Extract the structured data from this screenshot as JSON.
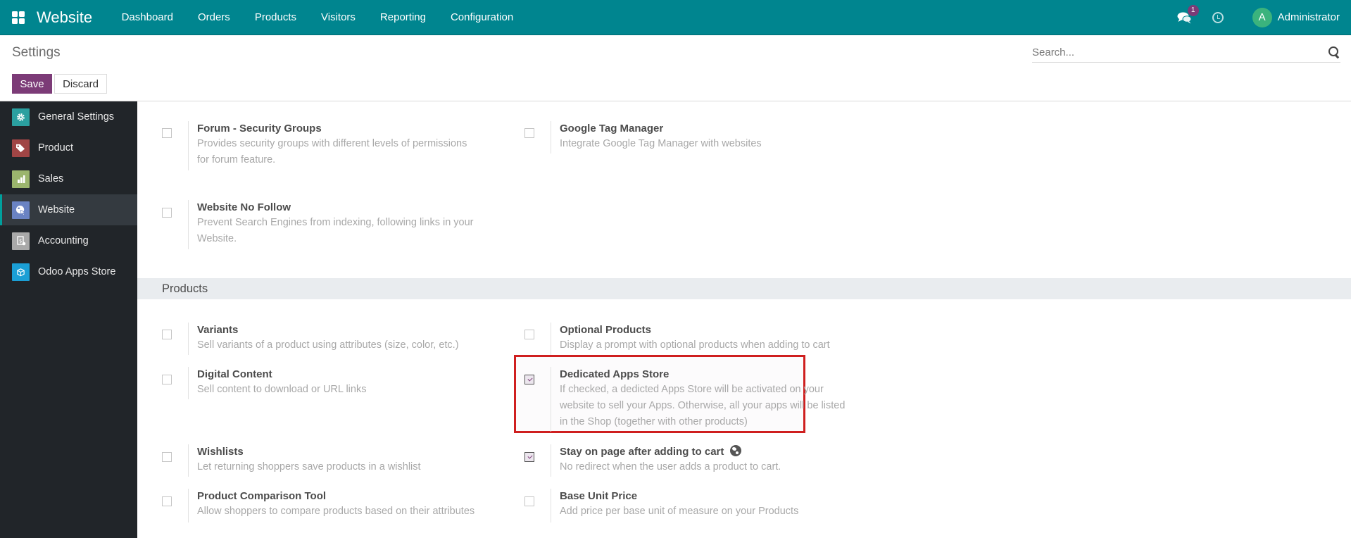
{
  "navbar": {
    "app_name": "Website",
    "menu": [
      "Dashboard",
      "Orders",
      "Products",
      "Visitors",
      "Reporting",
      "Configuration"
    ],
    "messages_badge": "1",
    "user_initial": "A",
    "user_name": "Administrator",
    "brand_color": "#00858f"
  },
  "control_panel": {
    "title": "Settings",
    "save_label": "Save",
    "discard_label": "Discard",
    "search_placeholder": "Search..."
  },
  "sidebar": {
    "items": [
      {
        "label": "General Settings",
        "icon": "gear-icon",
        "color": "#2ba0a0",
        "active": false
      },
      {
        "label": "Product",
        "icon": "tag-icon",
        "color": "#a04545",
        "active": false
      },
      {
        "label": "Sales",
        "icon": "chart-icon",
        "color": "#9bb56d",
        "active": false
      },
      {
        "label": "Website",
        "icon": "globe-cursor-icon",
        "color": "#6a83c3",
        "active": true
      },
      {
        "label": "Accounting",
        "icon": "invoice-icon",
        "color": "#a9a9a9",
        "active": false
      },
      {
        "label": "Odoo Apps Store",
        "icon": "cube-icon",
        "color": "#1b9fd5",
        "active": false
      }
    ]
  },
  "settings": {
    "top": [
      {
        "title": "Forum - Security Groups",
        "desc": [
          "Provides security groups with different levels of permissions",
          "for forum feature."
        ],
        "checked": false
      },
      {
        "title": "Google Tag Manager",
        "desc": [
          "Integrate Google Tag Manager with websites"
        ],
        "checked": false
      },
      {
        "title": "Website No Follow",
        "desc": [
          "Prevent Search Engines from indexing, following links in your",
          "Website."
        ],
        "checked": false
      }
    ],
    "products_section": {
      "header": "Products",
      "items": [
        {
          "title": "Variants",
          "desc": [
            "Sell variants of a product using attributes (size, color, etc.)"
          ],
          "checked": false
        },
        {
          "title": "Optional Products",
          "desc": [
            "Display a prompt with optional products when adding to cart"
          ],
          "checked": false
        },
        {
          "title": "Digital Content",
          "desc": [
            "Sell content to download or URL links"
          ],
          "checked": false
        },
        {
          "title": "Dedicated Apps Store",
          "desc": [
            "If checked, a dedicted Apps Store will be activated on your",
            "website to sell your Apps. Otherwise, all your apps will be listed",
            "in the Shop (together with other products)"
          ],
          "checked": true,
          "highlighted": true
        },
        {
          "title": "Wishlists",
          "desc": [
            "Let returning shoppers save products in a wishlist"
          ],
          "checked": false
        },
        {
          "title": "Stay on page after adding to cart",
          "desc": [
            "No redirect when the user adds a product to cart."
          ],
          "checked": true,
          "icon": "globe-icon"
        },
        {
          "title": "Product Comparison Tool",
          "desc": [
            "Allow shoppers to compare products based on their attributes"
          ],
          "checked": false
        },
        {
          "title": "Base Unit Price",
          "desc": [
            "Add price per base unit of measure on your Products"
          ],
          "checked": false
        }
      ]
    }
  }
}
